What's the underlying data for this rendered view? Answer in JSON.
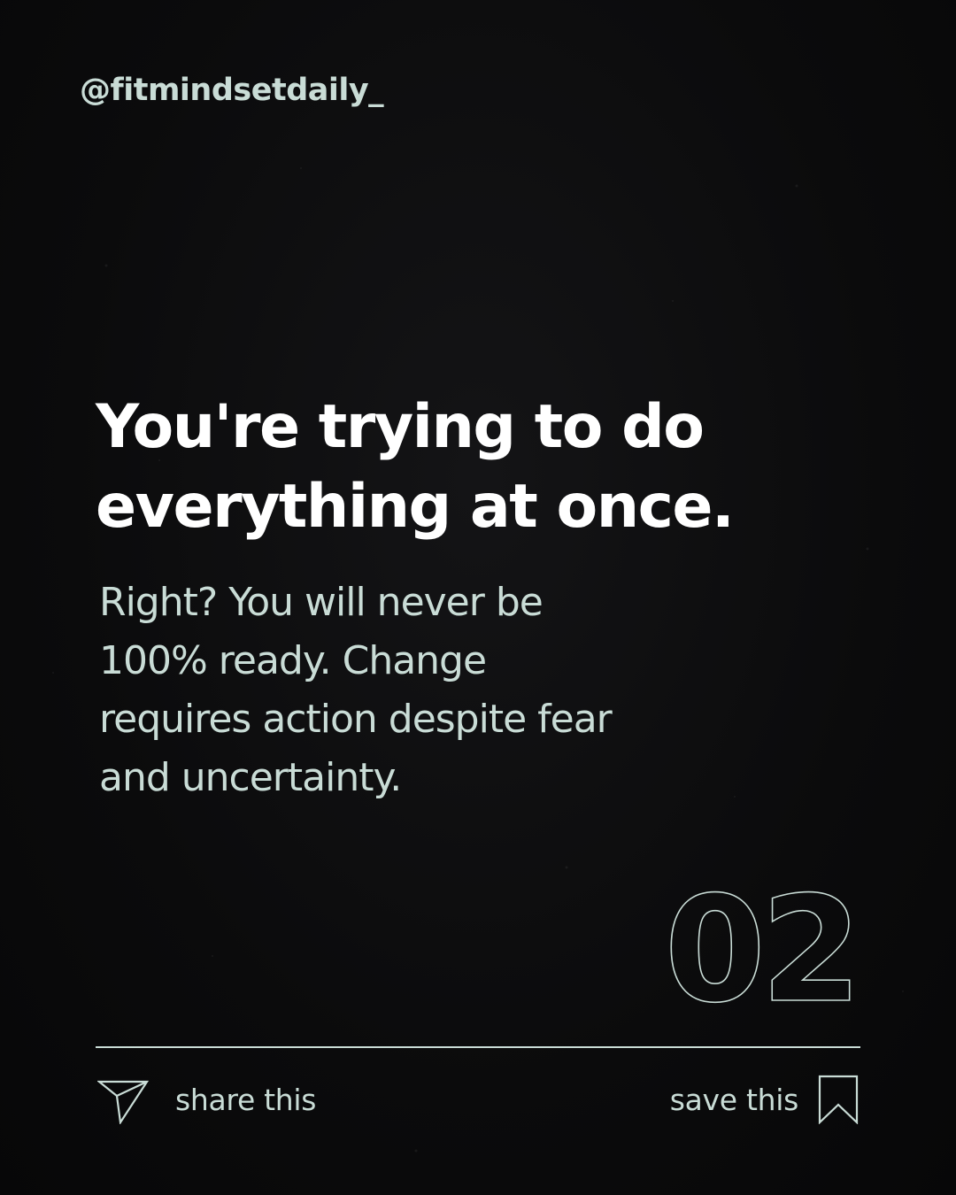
{
  "header": {
    "handle": "@fitmindsetdaily_"
  },
  "main": {
    "headline": "You're trying to do everything at once.",
    "body": "Right? You will never be 100% ready. Change requires action despite fear and uncertainty.",
    "page_number": "02"
  },
  "footer": {
    "share_label": "share this",
    "save_label": "save this",
    "share_icon": "paper-plane-icon",
    "save_icon": "bookmark-icon"
  },
  "colors": {
    "background": "#0a0a0b",
    "accent": "#c9dcd6",
    "headline": "#ffffff"
  }
}
